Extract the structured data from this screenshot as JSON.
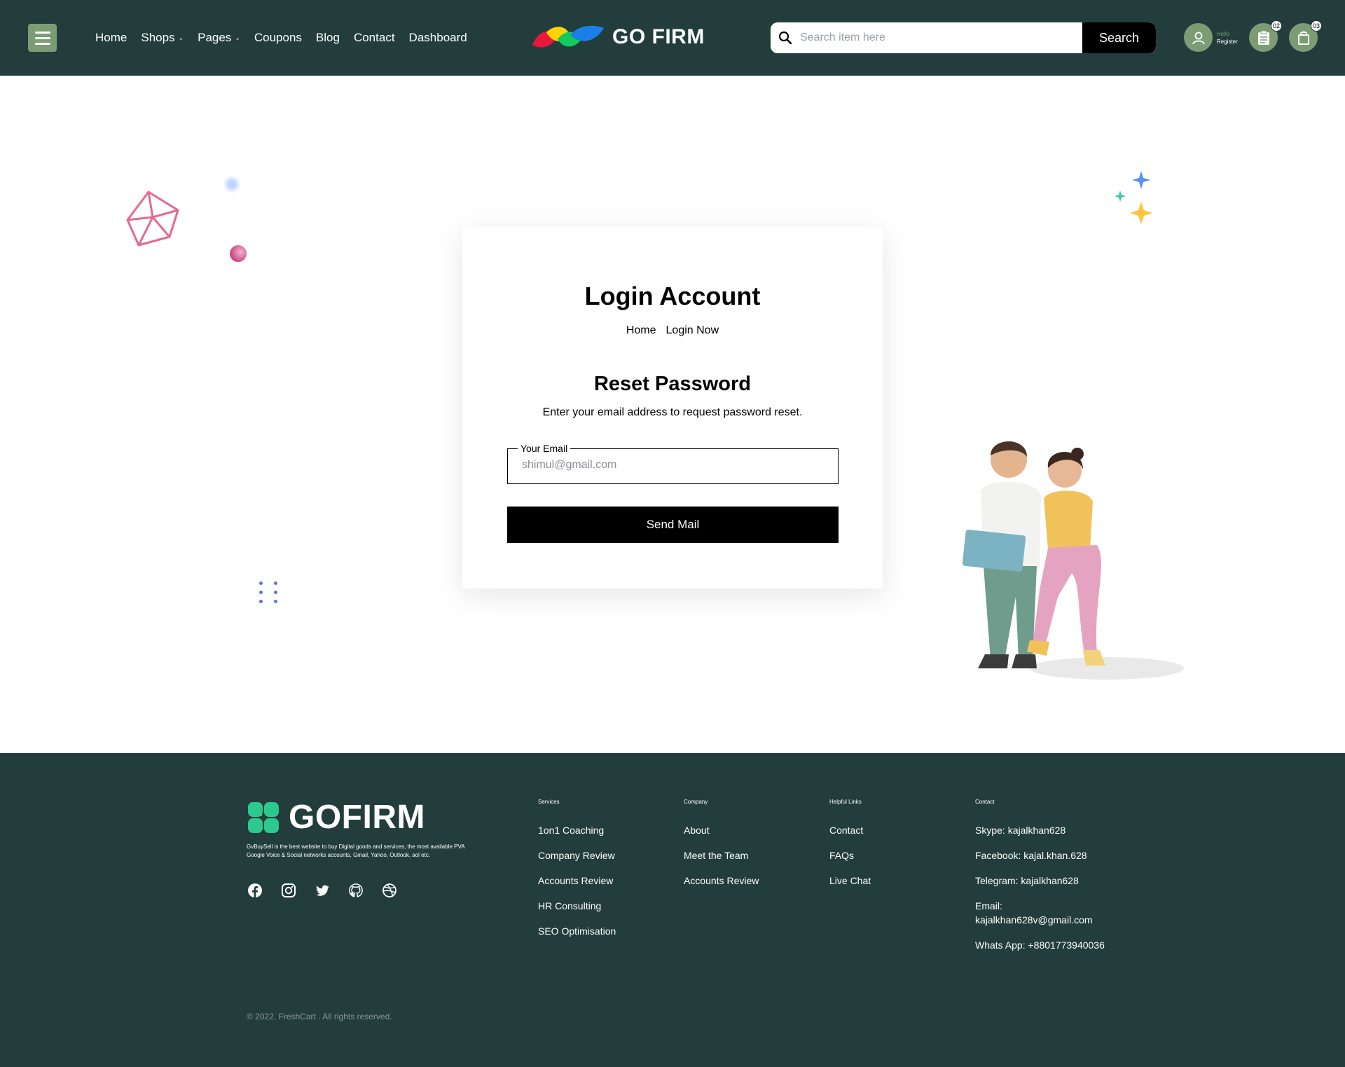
{
  "header": {
    "nav": [
      {
        "label": "Home",
        "caret": false
      },
      {
        "label": "Shops",
        "caret": true
      },
      {
        "label": "Pages",
        "caret": true
      },
      {
        "label": "Coupons",
        "caret": false
      },
      {
        "label": "Blog",
        "caret": false
      },
      {
        "label": "Contact",
        "caret": false
      },
      {
        "label": "Dashboard",
        "caret": false
      }
    ],
    "brand": "GO FIRM",
    "search": {
      "placeholder": "Search item here",
      "button": "Search"
    },
    "user": {
      "hello": "Hello",
      "register": "Register"
    },
    "list_badge": "02",
    "cart_badge": "03",
    "colors": {
      "bg": "#223d3c",
      "accent": "#7c9d74"
    }
  },
  "login": {
    "title": "Login Account",
    "breadcrumb": [
      "Home",
      "Login Now"
    ],
    "reset_title": "Reset Password",
    "reset_desc": "Enter your email address to request password reset.",
    "email_label": "Your Email",
    "email_placeholder": "shimul@gmail.com",
    "send_button": "Send Mail"
  },
  "footer": {
    "brand": "GOFIRM",
    "description": "GvBuySell is the best website to buy Digital goods and services, the most available PVA Google Voice & Social networks accounts, Gmail, Yahoo, Outlook, aol etc.",
    "social_icons": [
      "facebook-icon",
      "instagram-icon",
      "twitter-icon",
      "github-icon",
      "dribbble-icon"
    ],
    "columns": [
      {
        "heading": "Services",
        "links": [
          "1on1 Coaching",
          "Company Review",
          "Accounts Review",
          "HR Consulting",
          "SEO Optimisation"
        ]
      },
      {
        "heading": "Company",
        "links": [
          "About",
          "Meet the Team",
          "Accounts Review"
        ]
      },
      {
        "heading": "Helpful Links",
        "links": [
          "Contact",
          "FAQs",
          "Live Chat"
        ]
      },
      {
        "heading": "Contact",
        "links": [
          "Skype: kajalkhan628",
          "Facebook: kajal.khan.628",
          "Telegram: kajalkhan628",
          "Email: kajalkhan628v@gmail.com",
          "Whats App: +8801773940036"
        ]
      }
    ],
    "copyright": "© 2022. FreshCart . All rights reserved."
  }
}
